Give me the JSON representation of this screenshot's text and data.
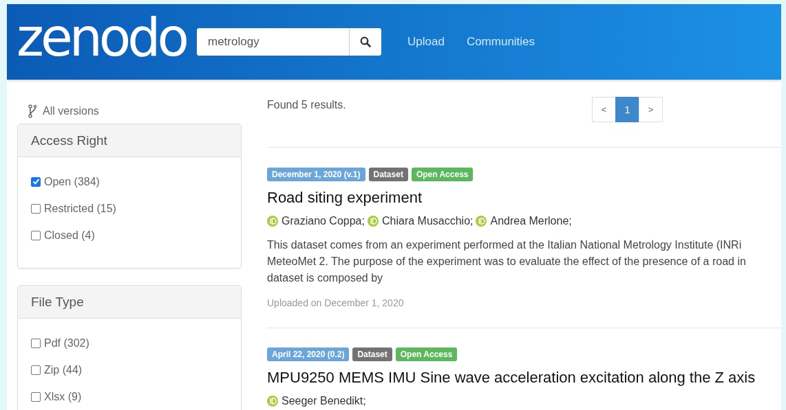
{
  "header": {
    "logo": "zenodo",
    "search": {
      "value": "metrology"
    },
    "nav": [
      "Upload",
      "Communities"
    ]
  },
  "sidebar": {
    "versions_link": "All versions",
    "facets": [
      {
        "title": "Access Right",
        "options": [
          {
            "label": "Open (384)",
            "checked": true
          },
          {
            "label": "Restricted (15)",
            "checked": false
          },
          {
            "label": "Closed (4)",
            "checked": false
          }
        ]
      },
      {
        "title": "File Type",
        "options": [
          {
            "label": "Pdf (302)",
            "checked": false
          },
          {
            "label": "Zip (44)",
            "checked": false
          },
          {
            "label": "Xlsx (9)",
            "checked": false
          }
        ]
      }
    ]
  },
  "results": {
    "summary": "Found 5 results.",
    "pagination": {
      "prev": "<",
      "next": ">",
      "pages": [
        {
          "label": "1",
          "selected": true
        }
      ]
    },
    "items": [
      {
        "badges": [
          {
            "kind": "date",
            "text": "December 1, 2020 (v.1)"
          },
          {
            "kind": "type",
            "text": "Dataset"
          },
          {
            "kind": "access",
            "text": "Open Access"
          }
        ],
        "title": "Road siting experiment",
        "authors": [
          "Graziano Coppa;",
          "Chiara Musacchio;",
          "Andrea Merlone;"
        ],
        "description": [
          "This dataset comes from an experiment performed at the Italian National Metrology Institute (INRi",
          "MeteoMet 2. The purpose of the experiment was to evaluate the effect of the presence of a road in",
          "dataset is composed by"
        ],
        "uploaded": "Uploaded on December 1, 2020"
      },
      {
        "badges": [
          {
            "kind": "date",
            "text": "April 22, 2020 (0.2)"
          },
          {
            "kind": "type",
            "text": "Dataset"
          },
          {
            "kind": "access",
            "text": "Open Access"
          }
        ],
        "title": "MPU9250 MEMS IMU Sine wave acceleration excitation along the Z axis",
        "authors": [
          "Seeger Benedikt;"
        ]
      }
    ]
  }
}
